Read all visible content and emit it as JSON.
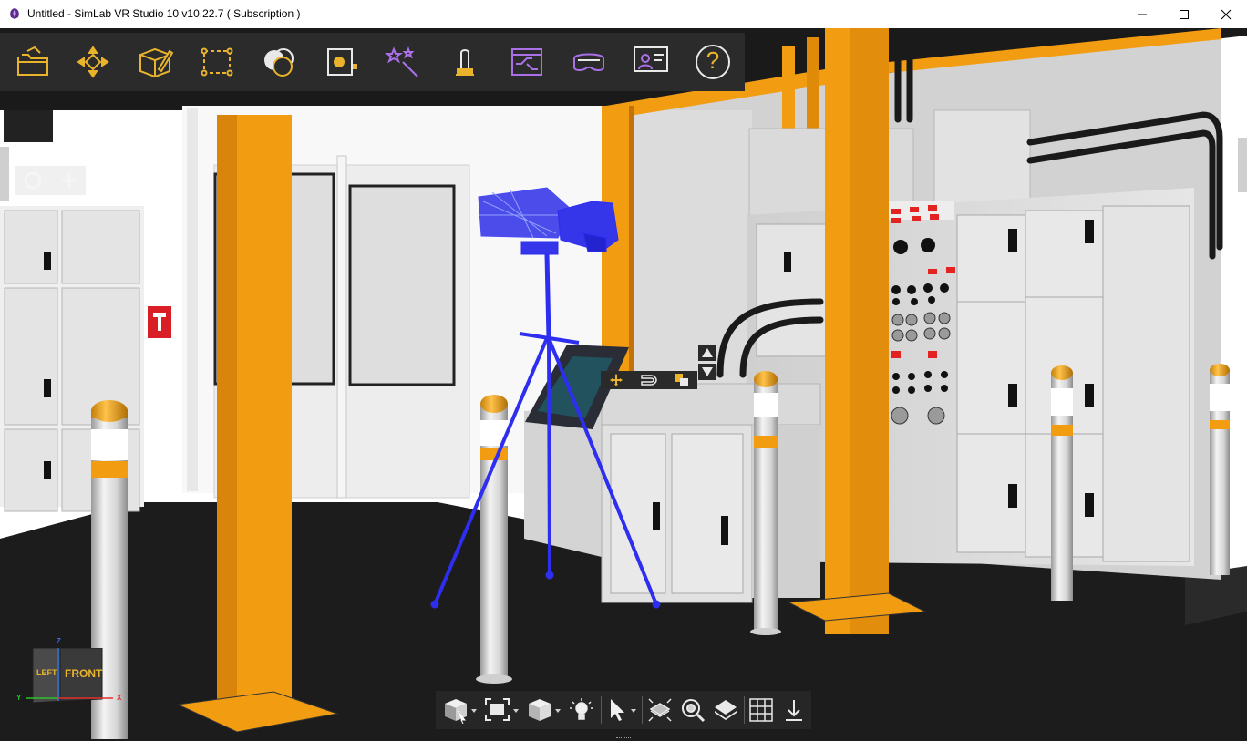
{
  "window": {
    "title": "Untitled - SimLab VR Studio 10 v10.22.7 ( Subscription )",
    "minimize_icon": "minimize-icon",
    "maximize_icon": "maximize-icon",
    "close_icon": "close-icon"
  },
  "main_toolbar": {
    "items": [
      {
        "icon": "open-folder-icon"
      },
      {
        "icon": "transform-move-icon"
      },
      {
        "icon": "edit-object-icon"
      },
      {
        "icon": "selection-box-icon"
      },
      {
        "icon": "materials-icon"
      },
      {
        "icon": "environment-icon"
      },
      {
        "icon": "magic-wand-icon"
      },
      {
        "icon": "interaction-touch-icon"
      },
      {
        "icon": "sequence-icon"
      },
      {
        "icon": "vr-headset-icon"
      },
      {
        "icon": "presentation-icon"
      },
      {
        "icon": "help-icon"
      }
    ],
    "help_label": "?"
  },
  "viewport_toolbar": {
    "items": [
      {
        "icon": "view-cube-icon"
      },
      {
        "icon": "fit-view-icon"
      },
      {
        "icon": "shading-mode-icon"
      },
      {
        "icon": "light-icon"
      },
      {
        "icon": "select-cursor-icon"
      },
      {
        "icon": "wireframe-plane-icon"
      },
      {
        "icon": "zoom-search-icon"
      },
      {
        "icon": "layers-icon"
      },
      {
        "icon": "grid-icon"
      },
      {
        "icon": "drop-to-floor-icon"
      }
    ]
  },
  "gizmo": {
    "left_label": "LEFT",
    "front_label": "FRONT",
    "axis_z": "Z",
    "axis_y": "Y",
    "axis_x": "X"
  },
  "colors": {
    "accent_gold": "#e9b32c",
    "accent_purple": "#a970e8",
    "toolbar_bg": "#2b2b2b",
    "pillar_orange": "#f29c12",
    "selection_blue": "#3333ee"
  }
}
